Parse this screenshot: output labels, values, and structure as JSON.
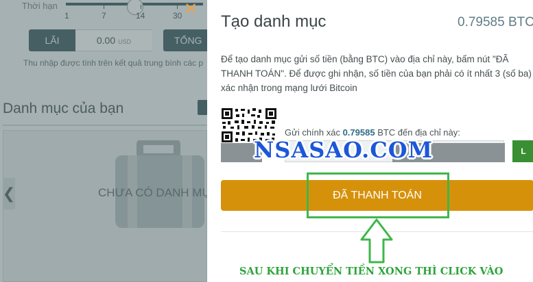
{
  "background": {
    "duration_label": "Thời hạn",
    "slider_ticks": [
      "1",
      "7",
      "14",
      "30"
    ],
    "close_glyph": "✕",
    "profit": {
      "label": "LÃI",
      "value": "0.00",
      "unit": "USD"
    },
    "total_tab_label": "TỔNG",
    "income_note": "Thu nhập được tính trên kết quả trung bình các p",
    "portfolio_title": "Danh mục của bạn",
    "empty_state": "CHƯA CÓ DANH MỤ",
    "prev_arrow": "❮"
  },
  "modal": {
    "title": "Tạo danh mục",
    "amount": "0.79585 BTC",
    "instructions": "Để tạo danh mục gửi số tiền (bằng BTC) vào địa chỉ này, bấm nút \"ĐÃ THANH TOÁN\". Để được ghi nhận, số tiền của bạn phải có ít nhất 3 (số ba) xác nhận trong mạng lưới Bitcoin",
    "send_prefix": "Gửi chính xác ",
    "send_amount": "0.79585",
    "send_suffix": " BTC đến địa chỉ này:",
    "copy_label": "L",
    "pay_button": "ĐÃ THANH TOÁN"
  },
  "overlay": {
    "watermark": "NSASAO.COM",
    "annotation": "SAU KHI CHUYỂN TIỀN XONG THÌ CLICK VÀO"
  },
  "colors": {
    "accent_orange": "#d6910b",
    "annotation_green": "#3fb64a",
    "watermark_blue": "#1d57d8",
    "dark_teal": "#2e4f55"
  },
  "icons": {
    "close": "close-icon",
    "briefcase": "briefcase-icon",
    "qr": "qr-code-icon",
    "arrow": "up-arrow-icon"
  }
}
